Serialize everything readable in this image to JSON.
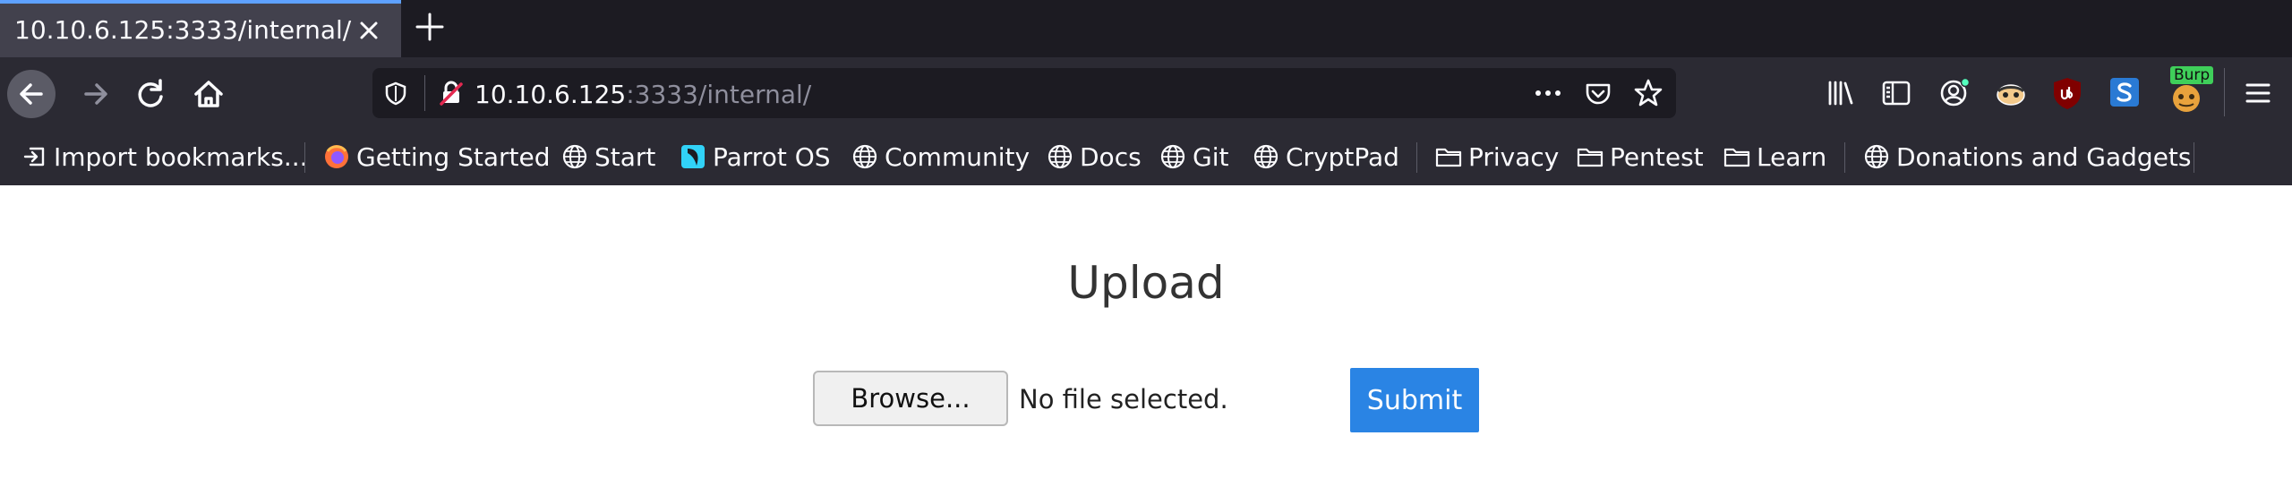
{
  "tab": {
    "title": "10.10.6.125:3333/internal/"
  },
  "urlbar": {
    "host": "10.10.6.125",
    "rest": ":3333/internal/"
  },
  "bookmarks": {
    "import": "Import bookmarks...",
    "items": [
      "Getting Started",
      "Start",
      "Parrot OS",
      "Community",
      "Docs",
      "Git",
      "CryptPad"
    ],
    "folders": [
      "Privacy",
      "Pentest",
      "Learn"
    ],
    "donations": "Donations and Gadgets"
  },
  "extensions": {
    "burp_badge": "Burp"
  },
  "page": {
    "heading": "Upload",
    "browse_label": "Browse...",
    "file_status": "No file selected.",
    "submit_label": "Submit"
  },
  "colors": {
    "tab_accent": "#5ea1ff",
    "submit": "#2a84e4",
    "toolbar": "#2b2a33",
    "tabbar": "#1c1b22"
  }
}
